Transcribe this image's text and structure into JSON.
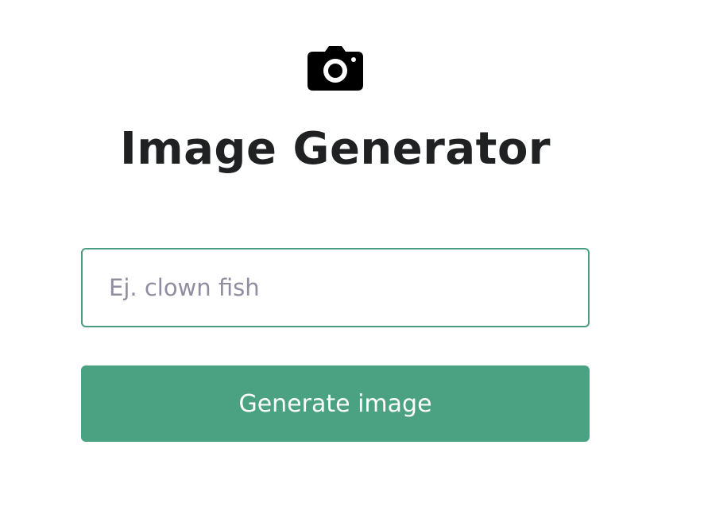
{
  "header": {
    "icon": "camera-icon",
    "title": "Image Generator"
  },
  "form": {
    "input_value": "",
    "input_placeholder": "Ej. clown fish",
    "submit_label": "Generate image"
  },
  "colors": {
    "title_text": "#202123",
    "input_border": "#4a9d82",
    "placeholder_text": "#8e8ea0",
    "button_background": "#4ba282",
    "button_text": "#ffffff"
  }
}
